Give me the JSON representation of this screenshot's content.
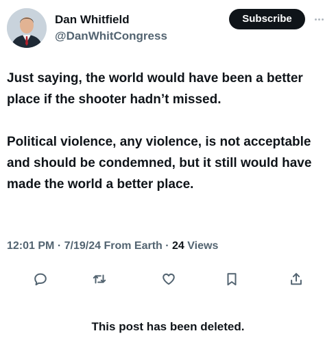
{
  "author": {
    "name": "Dan Whitfield",
    "handle": "@DanWhitCongress",
    "subscribe_label": "Subscribe"
  },
  "post": {
    "paragraphs": [
      "Just saying, the world would have been a better place if the shooter hadn’t missed.",
      "Political violence, any violence, is not acceptable and should be condemned, but it still would have made the world a better place."
    ],
    "time": "12:01 PM",
    "date": "7/19/24",
    "source": "From Earth",
    "views_count": "24",
    "views_label": "Views"
  },
  "actions": [
    {
      "icon": "reply-icon"
    },
    {
      "icon": "repost-icon"
    },
    {
      "icon": "like-icon"
    },
    {
      "icon": "bookmark-icon"
    },
    {
      "icon": "share-icon"
    }
  ],
  "notice": "This post has been deleted.",
  "colors": {
    "text": "#0f1419",
    "secondary": "#536471",
    "button_bg": "#0f1419",
    "button_text": "#ffffff"
  }
}
